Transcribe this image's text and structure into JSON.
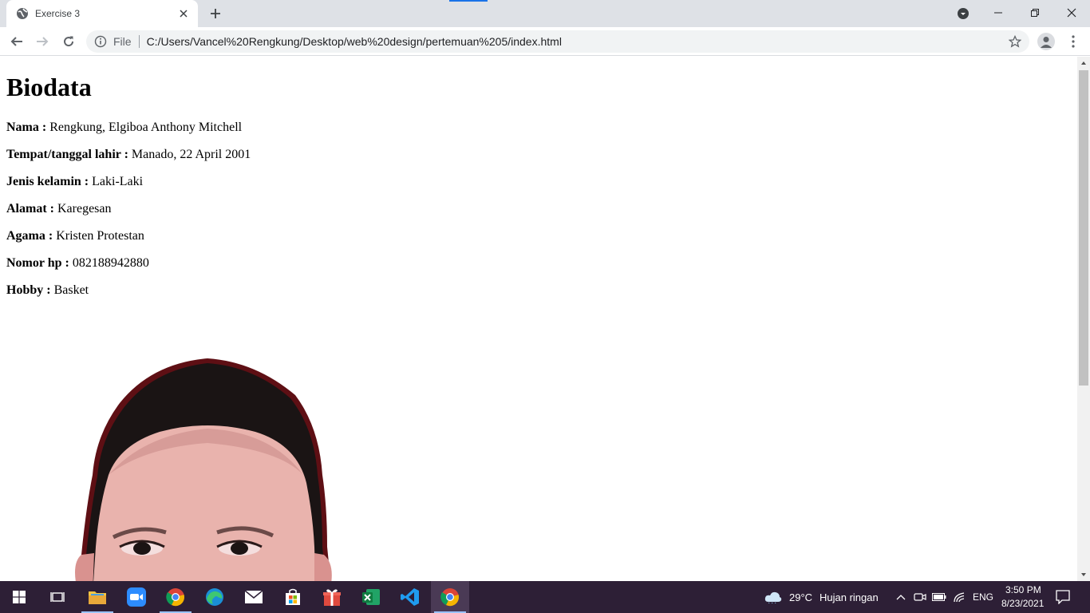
{
  "browser": {
    "tab_title": "Exercise 3",
    "omnibox_scheme": "File",
    "url": "C:/Users/Vancel%20Rengkung/Desktop/web%20design/pertemuan%205/index.html"
  },
  "page": {
    "heading": "Biodata",
    "fields": [
      {
        "label": "Nama :",
        "value": "Rengkung, Elgiboa Anthony Mitchell"
      },
      {
        "label": "Tempat/tanggal lahir :",
        "value": "Manado, 22 April 2001"
      },
      {
        "label": "Jenis kelamin :",
        "value": "Laki-Laki"
      },
      {
        "label": "Alamat :",
        "value": "Karegesan"
      },
      {
        "label": "Agama :",
        "value": "Kristen Protestan"
      },
      {
        "label": "Nomor hp :",
        "value": "082188942880"
      },
      {
        "label": "Hobby :",
        "value": "Basket"
      }
    ]
  },
  "taskbar": {
    "apps": [
      "start-icon",
      "task-view-icon",
      "file-explorer-icon",
      "zoom-icon",
      "chrome-icon",
      "edge-icon",
      "mail-icon",
      "store-icon",
      "gift-icon",
      "excel-icon",
      "vscode-icon",
      "chrome-icon"
    ],
    "weather_temp": "29°C",
    "weather_text": "Hujan ringan",
    "language": "ENG",
    "time": "3:50 PM",
    "date": "8/23/2021"
  },
  "colors": {
    "tabstrip": "#dee1e6",
    "taskbar": "#2d1f36",
    "accent": "#1a73e8"
  }
}
